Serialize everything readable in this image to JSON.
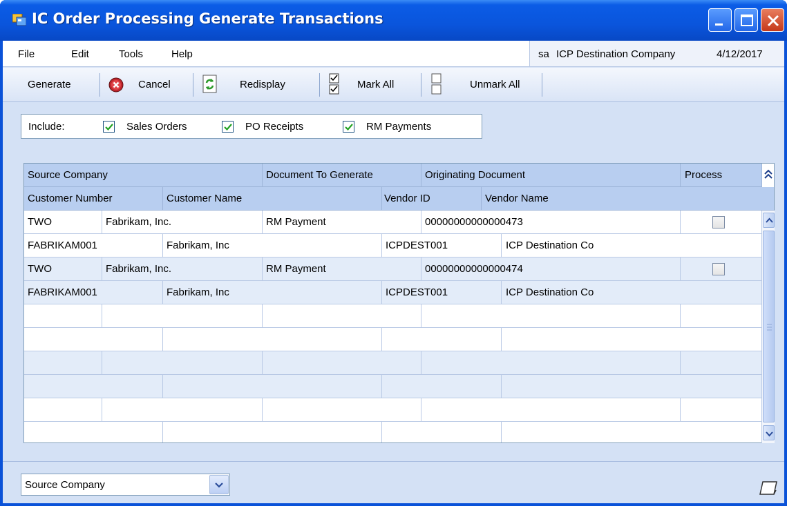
{
  "window": {
    "title": "IC Order Processing Generate Transactions"
  },
  "menu": {
    "file": "File",
    "edit": "Edit",
    "tools": "Tools",
    "help": "Help"
  },
  "user_info": {
    "user": "sa",
    "company": "ICP Destination Company",
    "date": "4/12/2017"
  },
  "toolbar": {
    "generate": "Generate",
    "cancel": "Cancel",
    "redisplay": "Redisplay",
    "mark_all": "Mark All",
    "unmark_all": "Unmark All"
  },
  "include": {
    "label": "Include:",
    "options": [
      {
        "label": "Sales Orders",
        "checked": true
      },
      {
        "label": "PO Receipts",
        "checked": true
      },
      {
        "label": "RM Payments",
        "checked": true
      }
    ]
  },
  "grid": {
    "header1": [
      "Source Company",
      "Document To Generate",
      "Originating Document",
      "Process"
    ],
    "header2": [
      "Customer Number",
      "Customer Name",
      "Vendor ID",
      "Vendor Name"
    ],
    "records": [
      {
        "source_company": "TWO",
        "company_name": "Fabrikam, Inc.",
        "document": "RM Payment",
        "originating": "00000000000000473",
        "process": false,
        "customer_number": "FABRIKAM001",
        "customer_name": "Fabrikam, Inc",
        "vendor_id": "ICPDEST001",
        "vendor_name": "ICP Destination Co"
      },
      {
        "source_company": "TWO",
        "company_name": "Fabrikam, Inc.",
        "document": "RM Payment",
        "originating": "00000000000000474",
        "process": false,
        "customer_number": "FABRIKAM001",
        "customer_name": "Fabrikam, Inc",
        "vendor_id": "ICPDEST001",
        "vendor_name": "ICP Destination Co"
      }
    ]
  },
  "sort": {
    "selected": "Source Company"
  },
  "colors": {
    "titlebar": "#0a55dc",
    "window_bg": "#d4e1f5",
    "header_bg": "#b8cef0",
    "alt_row": "#e3ecf9"
  }
}
